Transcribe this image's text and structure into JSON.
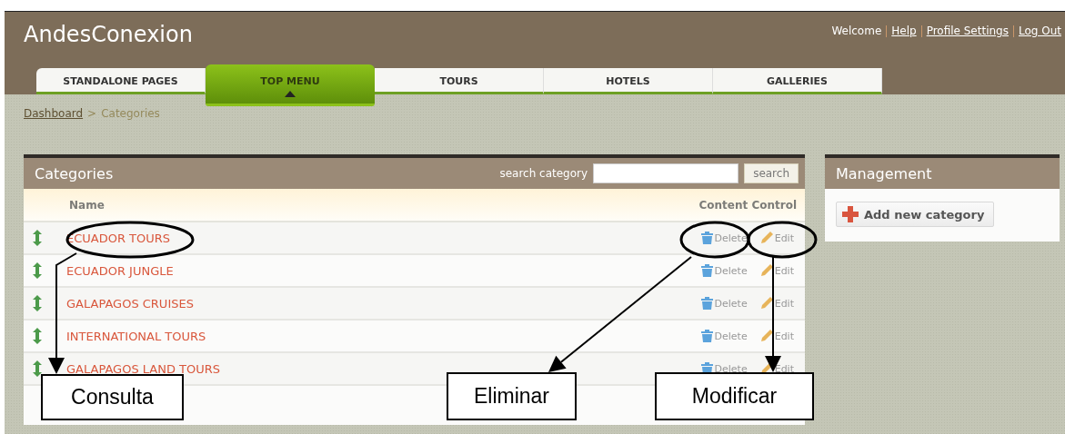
{
  "header": {
    "site_title": "AndesConexion",
    "user_links": [
      {
        "label": "Welcome",
        "kind": "text"
      },
      {
        "label": "Help",
        "kind": "link"
      },
      {
        "label": "Profile Settings",
        "kind": "link"
      },
      {
        "label": "Log Out",
        "kind": "link"
      }
    ]
  },
  "tabs": [
    {
      "label": "STANDALONE PAGES",
      "selected": false
    },
    {
      "label": "TOP MENU",
      "selected": true
    },
    {
      "label": "TOURS",
      "selected": false
    },
    {
      "label": "HOTELS",
      "selected": false
    },
    {
      "label": "GALLERIES",
      "selected": false
    }
  ],
  "breadcrumb": {
    "link": "Dashboard",
    "separator": ">",
    "current": "Categories"
  },
  "categories_panel": {
    "title": "Categories",
    "search_label": "search category",
    "search_button": "search",
    "columns": [
      "Name",
      "Content Control"
    ],
    "rows": [
      {
        "name": "ECUADOR TOURS",
        "delete": "Delete",
        "edit": "Edit"
      },
      {
        "name": "ECUADOR JUNGLE",
        "delete": "Delete",
        "edit": "Edit"
      },
      {
        "name": "GALAPAGOS CRUISES",
        "delete": "Delete",
        "edit": "Edit"
      },
      {
        "name": "INTERNATIONAL TOURS",
        "delete": "Delete",
        "edit": "Edit"
      },
      {
        "name": "GALAPAGOS LAND TOURS",
        "delete": "Delete",
        "edit": "Edit"
      }
    ]
  },
  "management_panel": {
    "title": "Management",
    "button": "Add new category"
  },
  "annotations": [
    {
      "label": "Consulta"
    },
    {
      "label": "Eliminar"
    },
    {
      "label": "Modificar"
    }
  ]
}
